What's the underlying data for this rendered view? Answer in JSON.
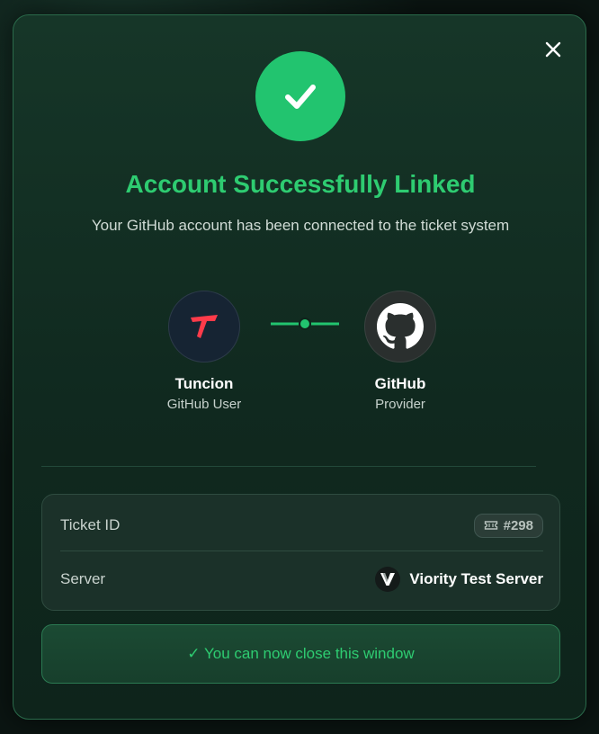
{
  "modal": {
    "title": "Account Successfully Linked",
    "subtitle": "Your GitHub account has been connected to the ticket system",
    "close_icon": "close-icon",
    "success_icon": "checkmark-icon"
  },
  "link": {
    "user": {
      "name": "Tuncion",
      "role": "GitHub User",
      "icon": "tuncion-logo-icon"
    },
    "provider": {
      "name": "GitHub",
      "role": "Provider",
      "icon": "github-octocat-icon"
    }
  },
  "details": {
    "ticket": {
      "label": "Ticket ID",
      "value": "#298",
      "icon": "ticket-icon"
    },
    "server": {
      "label": "Server",
      "value": "Viority Test Server",
      "icon": "viority-logo-icon"
    }
  },
  "footer": {
    "note": "✓ You can now close this window"
  },
  "colors": {
    "accent": "#2ecc71",
    "success_circle": "#22c46f",
    "modal_border": "#2a6a4a",
    "brand_red": "#ff3b4a"
  }
}
